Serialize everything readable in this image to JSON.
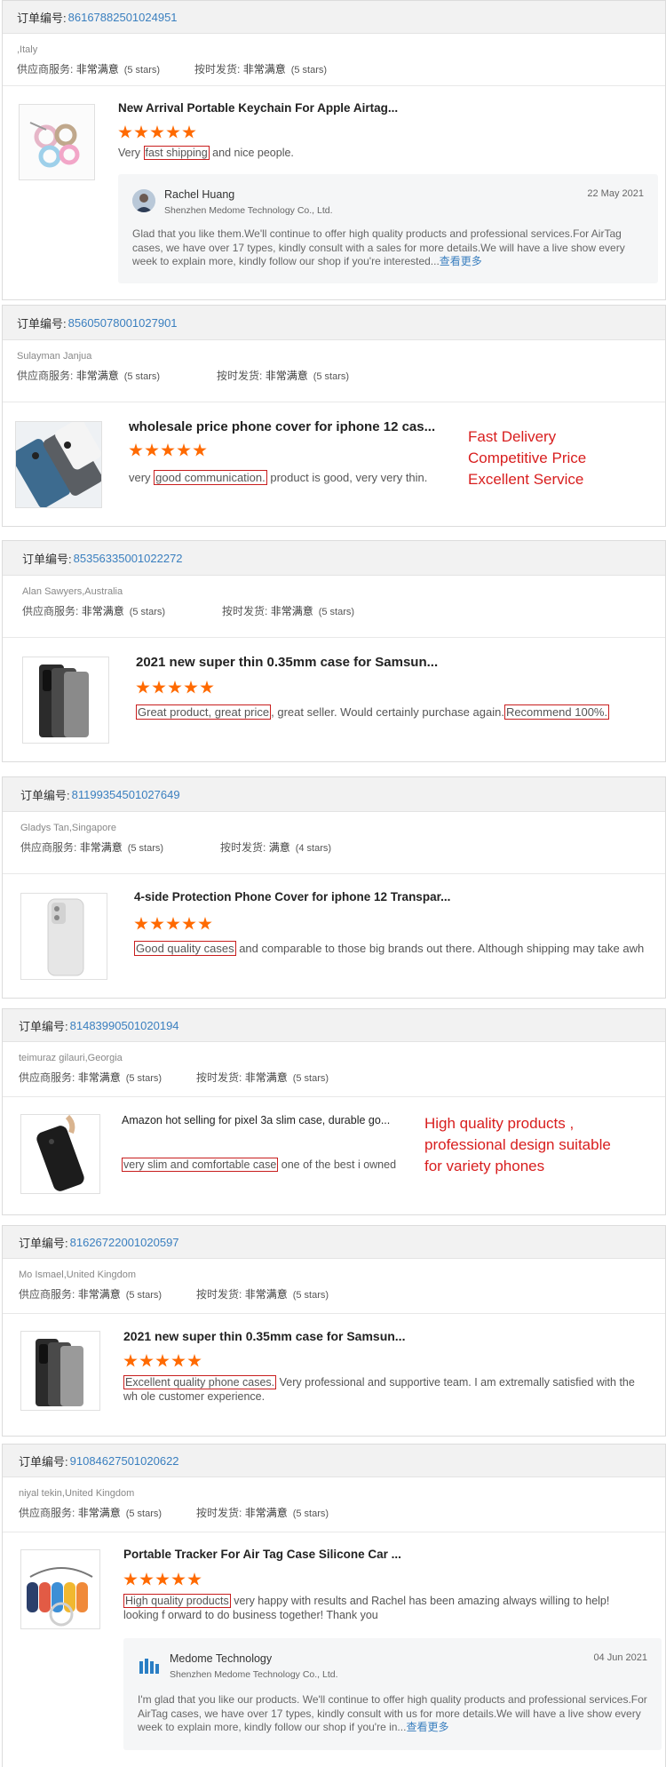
{
  "order_label": "订单编号:",
  "supplier_label": "供应商服务:",
  "shipping_label": "按时发货:",
  "reviews": [
    {
      "order_no": "86167882501024951",
      "location": ",Italy",
      "supplier_value": "非常满意",
      "supplier_stars": "(5 stars)",
      "shipping_value": "非常满意",
      "shipping_stars": "(5 stars)",
      "product_title": "New Arrival Portable Keychain For Apple Airtag...",
      "review_pre": "Very ",
      "review_hl1": "fast shipping",
      "review_mid": " and nice people.",
      "reply": {
        "name": "Rachel Huang",
        "company": "Shenzhen Medome Technology Co., Ltd.",
        "date": "22 May 2021",
        "text": "Glad that you like them.We'll continue to offer high quality products and professional services.For AirTag cases, we have over 17 types, kindly consult with a sales for more details.We will have a live show every week to explain more, kindly follow our shop if you're interested...",
        "more": "查看更多"
      }
    },
    {
      "order_no": "85605078001027901",
      "location": "Sulayman Janjua",
      "supplier_value": "非常满意",
      "supplier_stars": "(5 stars)",
      "shipping_value": "非常满意",
      "shipping_stars": "(5 stars)",
      "product_title": "wholesale price phone cover for iphone 12 cas...",
      "review_pre": "very ",
      "review_hl1": "good communication.",
      "review_mid": " product is good, very very thin.",
      "promo": [
        "Fast Delivery",
        "Competitive Price",
        "Excellent Service"
      ]
    },
    {
      "order_no": "85356335001022272",
      "location": "Alan Sawyers,Australia",
      "supplier_value": "非常满意",
      "supplier_stars": "(5 stars)",
      "shipping_value": "非常满意",
      "shipping_stars": "(5 stars)",
      "product_title": "2021 new super thin 0.35mm case for Samsun...",
      "review_hl1": "Great product, great price",
      "review_mid": ", great seller. Would certainly purchase again.",
      "review_hl2": "Recommend 100%."
    },
    {
      "order_no": "81199354501027649",
      "location": "Gladys Tan,Singapore",
      "supplier_value": "非常满意",
      "supplier_stars": "(5 stars)",
      "shipping_value": "满意",
      "shipping_stars": "(4 stars)",
      "product_title": "4-side Protection Phone Cover for iphone 12 Transpar...",
      "review_hl1": "Good quality cases",
      "review_mid": " and comparable to those big brands out there. Although shipping may take awh"
    },
    {
      "order_no": "81483990501020194",
      "location": "teimuraz gilauri,Georgia",
      "supplier_value": "非常满意",
      "supplier_stars": "(5 stars)",
      "shipping_value": "非常满意",
      "shipping_stars": "(5 stars)",
      "product_title": "Amazon hot selling for pixel 3a slim case, durable go...",
      "review_hl1": "very slim and comfortable case",
      "review_mid": " one of the best i owned",
      "promo": [
        "High quality products ,",
        "professional design suitable",
        "for variety phones"
      ]
    },
    {
      "order_no": "81626722001020597",
      "location": "Mo Ismael,United Kingdom",
      "supplier_value": "非常满意",
      "supplier_stars": "(5 stars)",
      "shipping_value": "非常满意",
      "shipping_stars": "(5 stars)",
      "product_title": "2021 new super thin 0.35mm case for Samsun...",
      "review_hl1": "Excellent quality phone cases.",
      "review_mid": " Very professional and supportive team. I am extremally satisfied with the wh ole customer experience."
    },
    {
      "order_no": "91084627501020622",
      "location": "niyal tekin,United Kingdom",
      "supplier_value": "非常满意",
      "supplier_stars": "(5 stars)",
      "shipping_value": "非常满意",
      "shipping_stars": "(5 stars)",
      "product_title": "Portable Tracker For Air Tag Case Silicone Car ...",
      "review_hl1": "High quality products",
      "review_mid": " very happy with results and Rachel has been amazing always willing to help! looking f orward to do business together! Thank you",
      "reply": {
        "name": "Medome Technology",
        "company": "Shenzhen Medome Technology Co., Ltd.",
        "date": "04 Jun 2021",
        "text": "I'm glad that you like our products. We'll continue to offer high quality products and professional services.For AirTag cases, we have over 17 types, kindly consult with us for more details.We will have a live show every week to explain more, kindly follow our shop if you're in...",
        "more": "查看更多"
      }
    }
  ]
}
